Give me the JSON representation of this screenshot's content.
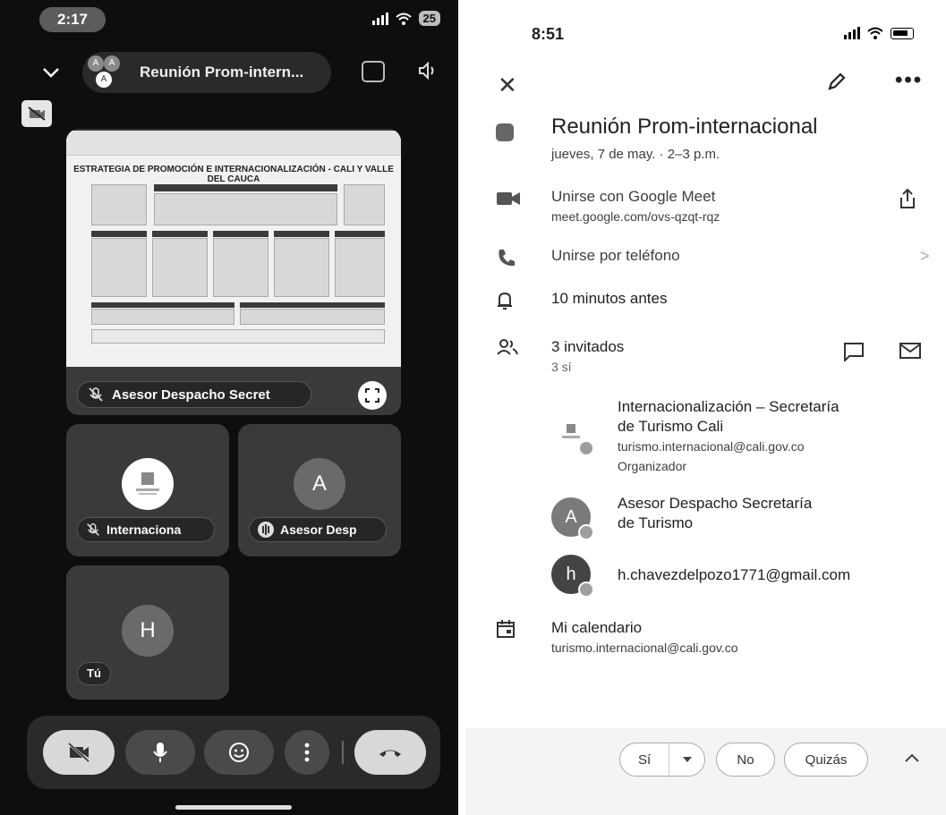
{
  "meet": {
    "status": {
      "time": "2:17",
      "battery": "25"
    },
    "header": {
      "title": "Reunión Prom-intern...",
      "cluster": [
        "A",
        "A",
        "A"
      ]
    },
    "presentation": {
      "slide_title": "ESTRATEGIA DE PROMOCIÓN E INTERNACIONALIZACIÓN - CALI Y VALLE DEL CAUCA",
      "presenter_label": "Asesor Despacho Secret"
    },
    "tiles": [
      {
        "name": "Internaciona",
        "avatar": "",
        "muted": true
      },
      {
        "name": "Asesor Desp",
        "avatar": "A",
        "muted": false
      },
      {
        "name": "Tú",
        "avatar": "H"
      }
    ]
  },
  "event": {
    "status": {
      "time": "8:51"
    },
    "title": "Reunión Prom-internacional",
    "datetime": "jueves, 7 de may. · 2–3 p.m.",
    "meet": {
      "label": "Unirse con Google Meet",
      "link": "meet.google.com/ovs-qzqt-rqz"
    },
    "phone": {
      "label": "Unirse por teléfono"
    },
    "reminder": "10 minutos antes",
    "guests": {
      "count": "3 invitados",
      "yes": "3 sí",
      "list": [
        {
          "name": "Internacionalización – Secretaría de Turismo Cali",
          "line1": "Internacionalización – Secretaría",
          "line2": "de Turismo Cali",
          "email": "turismo.internacional@cali.gov.co",
          "role": "Organizador"
        },
        {
          "initial": "A",
          "line1": "Asesor Despacho Secretaría",
          "line2": "de Turismo"
        },
        {
          "initial": "h",
          "line1": "h.chavezdelpozo1771@gmail.com"
        }
      ]
    },
    "calendar": {
      "label": "Mi calendario",
      "email": "turismo.internacional@cali.gov.co"
    },
    "rsvp": {
      "yes": "Sí",
      "no": "No",
      "maybe": "Quizás"
    }
  }
}
